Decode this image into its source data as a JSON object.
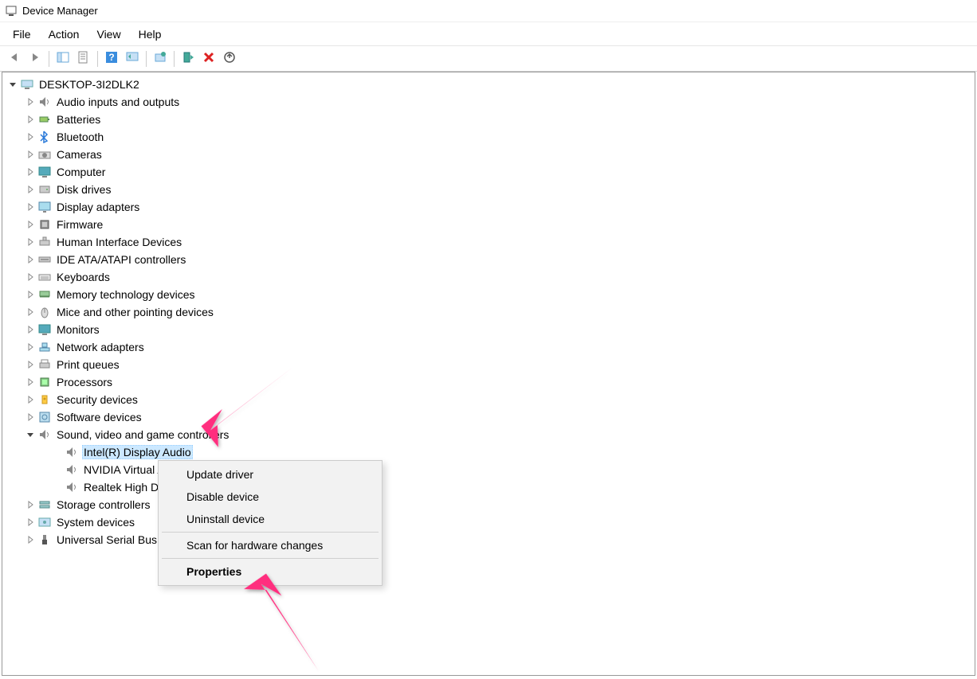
{
  "window": {
    "title": "Device Manager"
  },
  "menubar": [
    "File",
    "Action",
    "View",
    "Help"
  ],
  "toolbar": [
    {
      "name": "back-icon"
    },
    {
      "name": "forward-icon"
    },
    {
      "sep": true
    },
    {
      "name": "show-hide-icon"
    },
    {
      "name": "properties-icon"
    },
    {
      "sep": true
    },
    {
      "name": "help-icon"
    },
    {
      "name": "scan-hardware-icon"
    },
    {
      "sep": true
    },
    {
      "name": "update-driver-icon"
    },
    {
      "sep": true
    },
    {
      "name": "enable-device-icon"
    },
    {
      "name": "uninstall-device-icon"
    },
    {
      "name": "legacy-add-icon"
    }
  ],
  "tree": {
    "root": {
      "label": "DESKTOP-3I2DLK2",
      "icon": "computer-icon",
      "expanded": true
    },
    "categories": [
      {
        "label": "Audio inputs and outputs",
        "icon": "speaker-icon",
        "state": "collapsed"
      },
      {
        "label": "Batteries",
        "icon": "battery-icon",
        "state": "collapsed"
      },
      {
        "label": "Bluetooth",
        "icon": "bluetooth-icon",
        "state": "collapsed"
      },
      {
        "label": "Cameras",
        "icon": "camera-icon",
        "state": "collapsed"
      },
      {
        "label": "Computer",
        "icon": "monitor-icon",
        "state": "collapsed"
      },
      {
        "label": "Disk drives",
        "icon": "disk-icon",
        "state": "collapsed"
      },
      {
        "label": "Display adapters",
        "icon": "display-icon",
        "state": "collapsed"
      },
      {
        "label": "Firmware",
        "icon": "chip-icon",
        "state": "collapsed"
      },
      {
        "label": "Human Interface Devices",
        "icon": "hid-icon",
        "state": "collapsed"
      },
      {
        "label": "IDE ATA/ATAPI controllers",
        "icon": "ide-icon",
        "state": "collapsed"
      },
      {
        "label": "Keyboards",
        "icon": "keyboard-icon",
        "state": "collapsed"
      },
      {
        "label": "Memory technology devices",
        "icon": "memory-icon",
        "state": "collapsed"
      },
      {
        "label": "Mice and other pointing devices",
        "icon": "mouse-icon",
        "state": "collapsed"
      },
      {
        "label": "Monitors",
        "icon": "monitor-icon",
        "state": "collapsed"
      },
      {
        "label": "Network adapters",
        "icon": "network-icon",
        "state": "collapsed"
      },
      {
        "label": "Print queues",
        "icon": "printer-icon",
        "state": "collapsed"
      },
      {
        "label": "Processors",
        "icon": "cpu-icon",
        "state": "collapsed"
      },
      {
        "label": "Security devices",
        "icon": "security-icon",
        "state": "collapsed"
      },
      {
        "label": "Software devices",
        "icon": "software-icon",
        "state": "collapsed"
      },
      {
        "label": "Sound, video and game controllers",
        "icon": "speaker-icon",
        "state": "expanded",
        "children": [
          {
            "label": "Intel(R) Display Audio",
            "icon": "speaker-icon",
            "selected": true
          },
          {
            "label": "NVIDIA Virtual Audio Device (Wave Extensible) (WDM)",
            "icon": "speaker-icon"
          },
          {
            "label": "Realtek High Definition Audio",
            "icon": "speaker-icon"
          }
        ]
      },
      {
        "label": "Storage controllers",
        "icon": "storage-icon",
        "state": "collapsed"
      },
      {
        "label": "System devices",
        "icon": "system-icon",
        "state": "collapsed"
      },
      {
        "label": "Universal Serial Bus controllers",
        "icon": "usb-icon",
        "state": "collapsed"
      }
    ]
  },
  "context_menu": [
    {
      "label": "Update driver"
    },
    {
      "label": "Disable device"
    },
    {
      "label": "Uninstall device"
    },
    {
      "sep": true
    },
    {
      "label": "Scan for hardware changes"
    },
    {
      "sep": true
    },
    {
      "label": "Properties",
      "bold": true
    }
  ],
  "annotations": {
    "arrow_color": "#ff2e7e"
  }
}
